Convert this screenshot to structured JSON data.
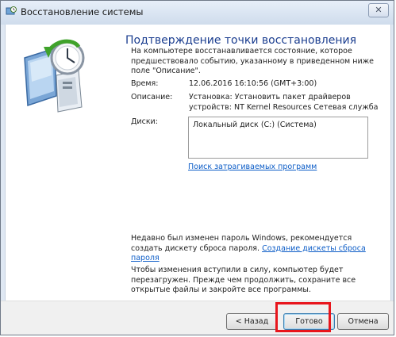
{
  "window": {
    "title": "Восстановление системы",
    "close_glyph": "✕",
    "title_icon": "system-restore-icon"
  },
  "main": {
    "heading": "Подтверждение точки восстановления",
    "intro": "На компьютере восстанавливается состояние, которое предшествовало событию, указанному в приведенном ниже поле \"Описание\".",
    "time_label": "Время:",
    "time_value": "12.06.2016 16:10:56 (GMT+3:00)",
    "description_label": "Описание:",
    "description_line1": "Установка: Установить пакет драйверов",
    "description_line2": "устройств: NT Kernel Resources Сетевая служба",
    "disks_label": "Диски:",
    "disks_value": "Локальный диск (C:) (Система)",
    "affected_programs_link": "Поиск затрагиваемых программ",
    "password_note_text": "Недавно был изменен пароль Windows, рекомендуется создать дискету сброса пароля.",
    "password_reset_link": "Создание дискеты сброса пароля",
    "restart_note": "Чтобы изменения вступили в силу, компьютер будет перезагружен. Прежде чем продолжить, сохраните все открытые файлы и закройте все программы."
  },
  "buttons": {
    "back": "< Назад",
    "finish": "Готово",
    "cancel": "Отмена"
  },
  "colors": {
    "heading": "#1a3d8f",
    "link": "#0b5cc7",
    "highlight": "#e8151c"
  }
}
